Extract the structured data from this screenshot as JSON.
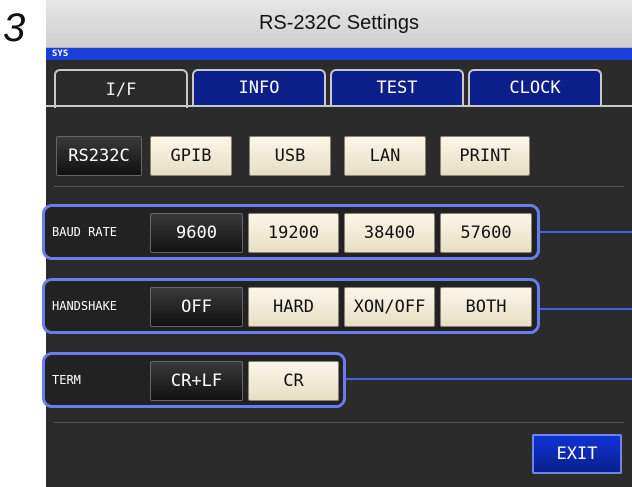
{
  "step": "3",
  "title": "RS-232C Settings",
  "sys_label": "SYS",
  "tabs": [
    {
      "label": "I/F",
      "active": true
    },
    {
      "label": "INFO",
      "active": false
    },
    {
      "label": "TEST",
      "active": false
    },
    {
      "label": "CLOCK",
      "active": false
    }
  ],
  "interfaces": [
    "RS232C",
    "GPIB",
    "USB",
    "LAN",
    "PRINT"
  ],
  "baud_rate": {
    "label": "BAUD RATE",
    "options": [
      "9600",
      "19200",
      "38400",
      "57600"
    ],
    "selected": "9600"
  },
  "handshake": {
    "label": "HANDSHAKE",
    "options": [
      "OFF",
      "HARD",
      "XON/OFF",
      "BOTH"
    ],
    "selected": "OFF"
  },
  "term": {
    "label": "TERM",
    "options": [
      "CR+LF",
      "CR"
    ],
    "selected": "CR+LF"
  },
  "exit_label": "EXIT",
  "colors": {
    "accent_blue": "#0a1f8a",
    "highlight": "#6b7cf0",
    "selected": "#111111",
    "option": "#f3eedb"
  }
}
